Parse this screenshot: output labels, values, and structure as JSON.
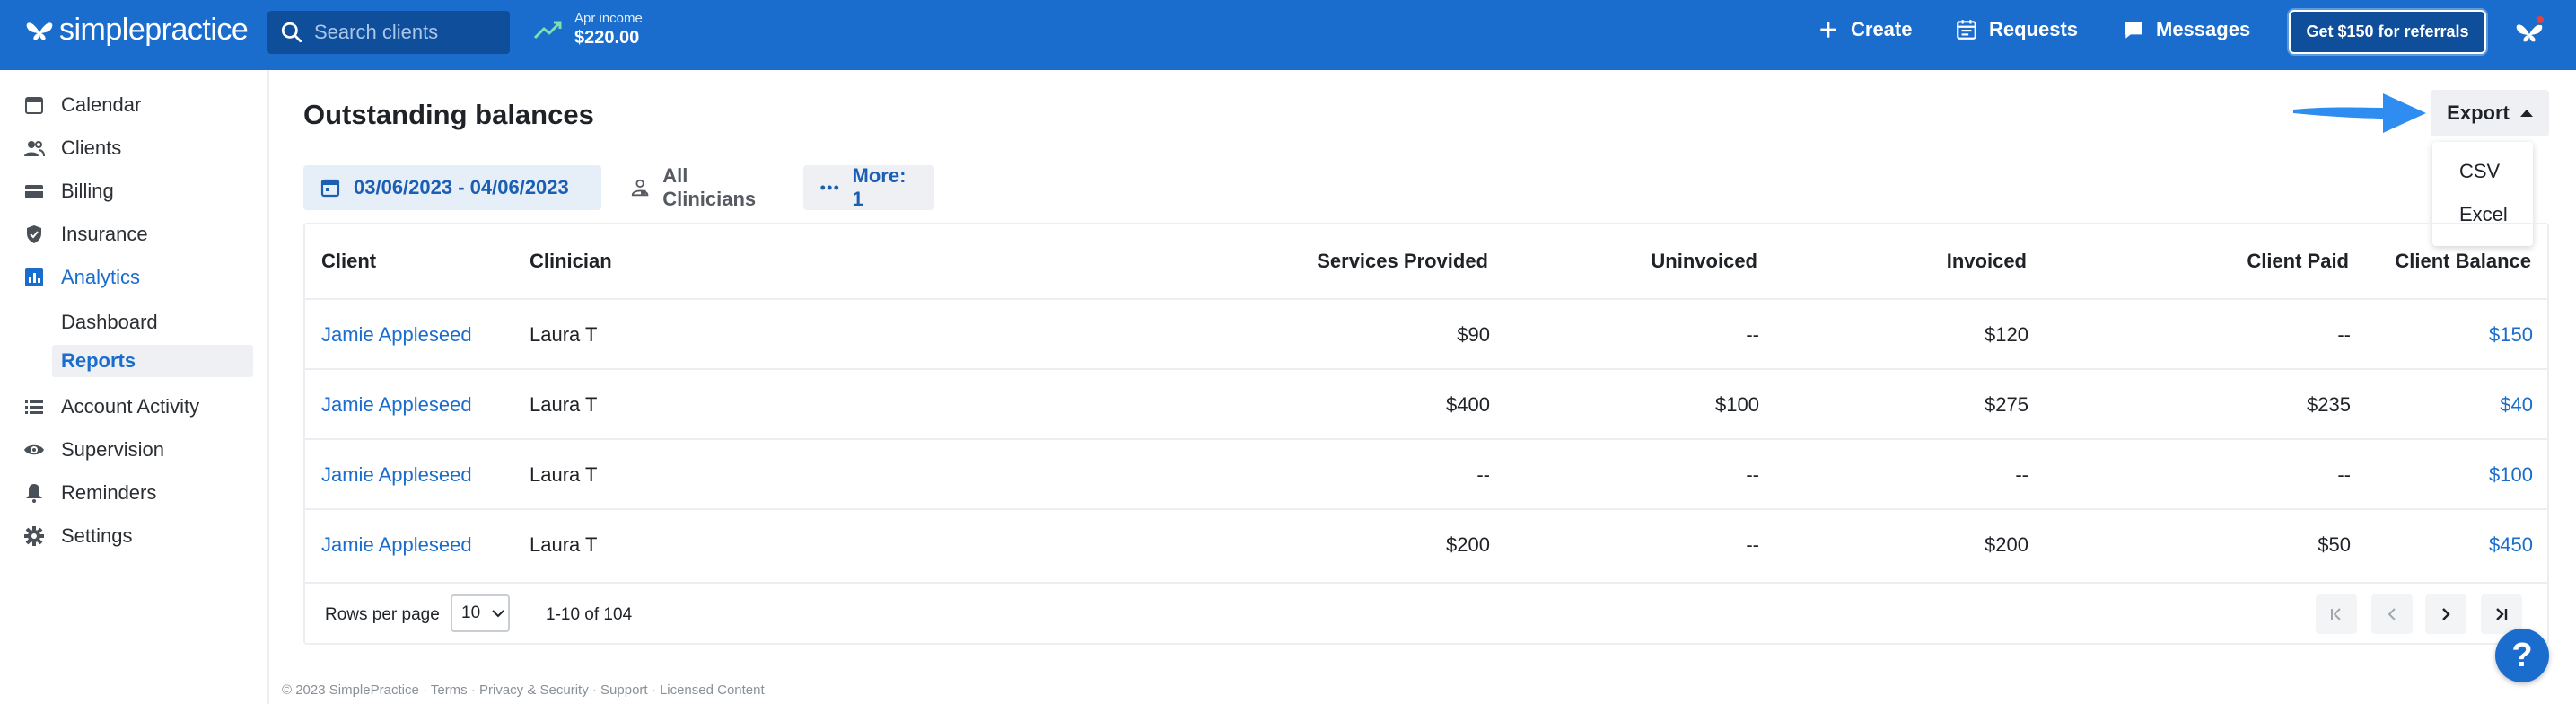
{
  "app": {
    "logo_text": "simplepractice"
  },
  "topbar": {
    "search_placeholder": "Search clients",
    "income_label": "Apr income",
    "income_value": "$220.00",
    "create": "Create",
    "requests": "Requests",
    "messages": "Messages",
    "referral": "Get $150 for referrals"
  },
  "sidebar": {
    "items": [
      {
        "label": "Calendar",
        "icon": "calendar-icon"
      },
      {
        "label": "Clients",
        "icon": "clients-icon"
      },
      {
        "label": "Billing",
        "icon": "billing-card-icon"
      },
      {
        "label": "Insurance",
        "icon": "shield-icon"
      },
      {
        "label": "Analytics",
        "icon": "bar-chart-icon"
      },
      {
        "label": "Account Activity",
        "icon": "list-icon"
      },
      {
        "label": "Supervision",
        "icon": "eye-icon"
      },
      {
        "label": "Reminders",
        "icon": "bell-icon"
      },
      {
        "label": "Settings",
        "icon": "gear-icon"
      }
    ],
    "analytics_sub": [
      "Dashboard",
      "Reports"
    ]
  },
  "page": {
    "title": "Outstanding balances",
    "export_label": "Export",
    "export_options": [
      "CSV",
      "Excel"
    ]
  },
  "filters": {
    "date_range": "03/06/2023 - 04/06/2023",
    "clinicians": "All Clinicians",
    "more": "More: 1"
  },
  "table": {
    "columns": [
      "Client",
      "Clinician",
      "Services Provided",
      "Uninvoiced",
      "Invoiced",
      "Client Paid",
      "Client Balance"
    ],
    "rows": [
      {
        "client": "Jamie Appleseed",
        "clinician": "Laura T",
        "services": "$90",
        "uninvoiced": "--",
        "invoiced": "$120",
        "paid": "--",
        "balance": "$150"
      },
      {
        "client": "Jamie Appleseed",
        "clinician": "Laura T",
        "services": "$400",
        "uninvoiced": "$100",
        "invoiced": "$275",
        "paid": "$235",
        "balance": "$40"
      },
      {
        "client": "Jamie Appleseed",
        "clinician": "Laura T",
        "services": "--",
        "uninvoiced": "--",
        "invoiced": "--",
        "paid": "--",
        "balance": "$100"
      },
      {
        "client": "Jamie Appleseed",
        "clinician": "Laura T",
        "services": "$200",
        "uninvoiced": "--",
        "invoiced": "$200",
        "paid": "$50",
        "balance": "$450"
      }
    ]
  },
  "pagination": {
    "rows_per_page_label": "Rows per page",
    "rows_per_page_value": "10",
    "range": "1-10 of 104"
  },
  "footer": {
    "copyright": "© 2023 SimplePractice · Terms · Privacy & Security · Support · Licensed Content"
  },
  "help": {
    "label": "?"
  },
  "colors": {
    "brand": "#1a6dcc",
    "link": "#1a6dcc",
    "arrow": "#2f8cf0"
  }
}
